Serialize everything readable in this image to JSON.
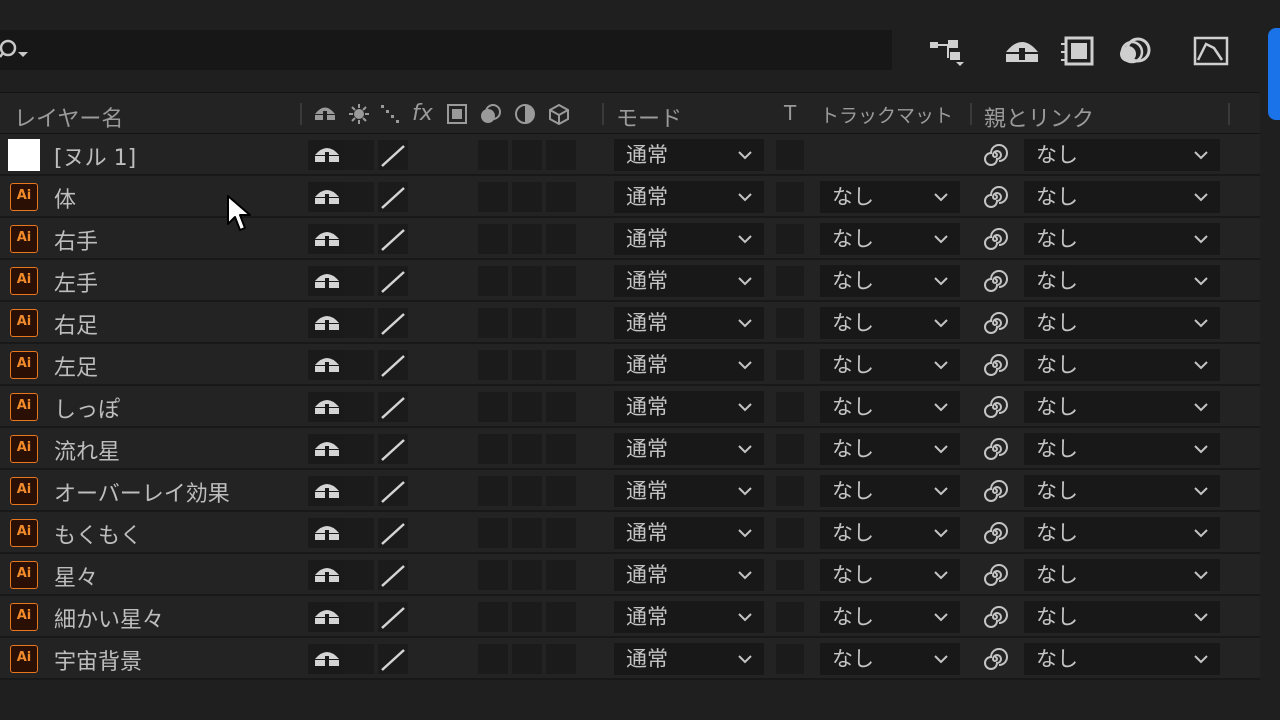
{
  "header": {
    "layer_name": "レイヤー名",
    "fx": "fx",
    "mode": "モード",
    "t": "T",
    "track_matte": "トラックマット",
    "parent_link": "親とリンク"
  },
  "layers": [
    {
      "name": "[ヌル 1]",
      "type": "null",
      "mode": "通常",
      "matte": "",
      "parent": "なし"
    },
    {
      "name": "体",
      "type": "ai",
      "mode": "通常",
      "matte": "なし",
      "parent": "なし"
    },
    {
      "name": "右手",
      "type": "ai",
      "mode": "通常",
      "matte": "なし",
      "parent": "なし"
    },
    {
      "name": "左手",
      "type": "ai",
      "mode": "通常",
      "matte": "なし",
      "parent": "なし"
    },
    {
      "name": "右足",
      "type": "ai",
      "mode": "通常",
      "matte": "なし",
      "parent": "なし"
    },
    {
      "name": "左足",
      "type": "ai",
      "mode": "通常",
      "matte": "なし",
      "parent": "なし"
    },
    {
      "name": "しっぽ",
      "type": "ai",
      "mode": "通常",
      "matte": "なし",
      "parent": "なし"
    },
    {
      "name": "流れ星",
      "type": "ai",
      "mode": "通常",
      "matte": "なし",
      "parent": "なし"
    },
    {
      "name": "オーバーレイ効果",
      "type": "ai",
      "mode": "通常",
      "matte": "なし",
      "parent": "なし"
    },
    {
      "name": "もくもく",
      "type": "ai",
      "mode": "通常",
      "matte": "なし",
      "parent": "なし"
    },
    {
      "name": "星々",
      "type": "ai",
      "mode": "通常",
      "matte": "なし",
      "parent": "なし"
    },
    {
      "name": "細かい星々",
      "type": "ai",
      "mode": "通常",
      "matte": "なし",
      "parent": "なし"
    },
    {
      "name": "宇宙背景",
      "type": "ai",
      "mode": "通常",
      "matte": "なし",
      "parent": "なし"
    }
  ],
  "ai_icon_label": "Ai",
  "icons": {
    "search": "search-icon",
    "flowchart": "composition-flowchart-icon",
    "shy": "shy-icon",
    "frame_blend": "frame-blending-icon",
    "motion_blur": "motion-blur-icon",
    "graph": "graph-editor-icon"
  },
  "colors": {
    "accent": "#1a73e8",
    "ai_orange": "#e8761e",
    "background": "#1f1f1f"
  }
}
